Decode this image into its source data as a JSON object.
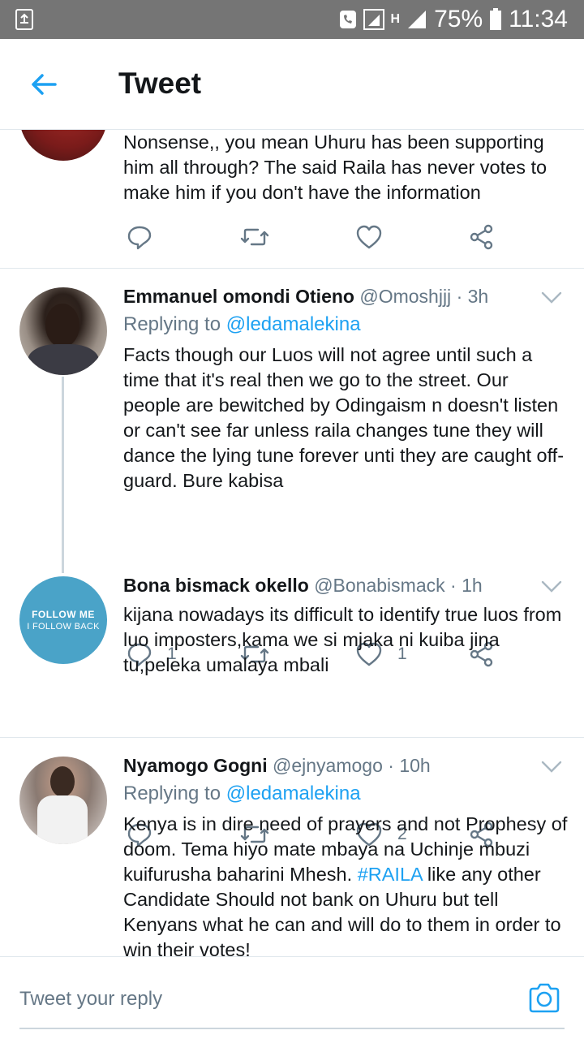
{
  "status_bar": {
    "battery": "75%",
    "time": "11:34",
    "network": "H"
  },
  "header": {
    "title": "Tweet"
  },
  "tweets": [
    {
      "name": "",
      "handle": "",
      "time": "",
      "body": "Nonsense,, you mean Uhuru has been supporting him all through? The said Raila has never votes to make him if you don't have the information",
      "replies": "",
      "likes": ""
    },
    {
      "name": "Emmanuel omondi Otieno",
      "handle": "@Omoshjjj",
      "time": "· 3h",
      "replying_prefix": "Replying to ",
      "replying_to": "@ledamalekina",
      "body": "Facts though our Luos will not agree until such a time that it's real then we go to the street. Our people are bewitched by Odingaism n doesn't listen or can't see far unless raila changes tune they will dance the lying tune forever unti they are caught off-guard. Bure kabisa",
      "replies": "1",
      "likes": "1"
    },
    {
      "name": "Bona bismack okello",
      "handle": "@Bonabismack",
      "time": "· 1h",
      "avatar_text_1": "FOLLOW ME",
      "avatar_text_2": "I FOLLOW BACK",
      "body": "kijana nowadays its difficult to identify true luos from luo imposters,kama we si mjaka ni kuiba jina tu,peleka umalaya mbali",
      "replies": "",
      "likes": "2"
    },
    {
      "name": "Nyamogo Gogni",
      "handle": "@ejnyamogo",
      "time": "· 10h",
      "replying_prefix": "Replying to ",
      "replying_to": "@ledamalekina",
      "body_before": "Kenya is in dire need of prayers and not Prophesy of doom. Tema hiyo mate mbaya na Uchinje mbuzi kuifurusha baharini Mhesh. ",
      "hashtag": "#RAILA",
      "body_after": " like any other Candidate Should not bank on Uhuru but tell Kenyans what he can and will do to them in order to win their votes!"
    }
  ],
  "reply_bar": {
    "placeholder": "Tweet your reply"
  },
  "colors": {
    "accent": "#1da1f2",
    "secondary_text": "#657786",
    "status_bar": "#757575"
  },
  "icons": [
    "back-arrow-icon",
    "reply-icon",
    "retweet-icon",
    "like-icon",
    "share-icon",
    "chevron-down-icon",
    "camera-icon"
  ]
}
